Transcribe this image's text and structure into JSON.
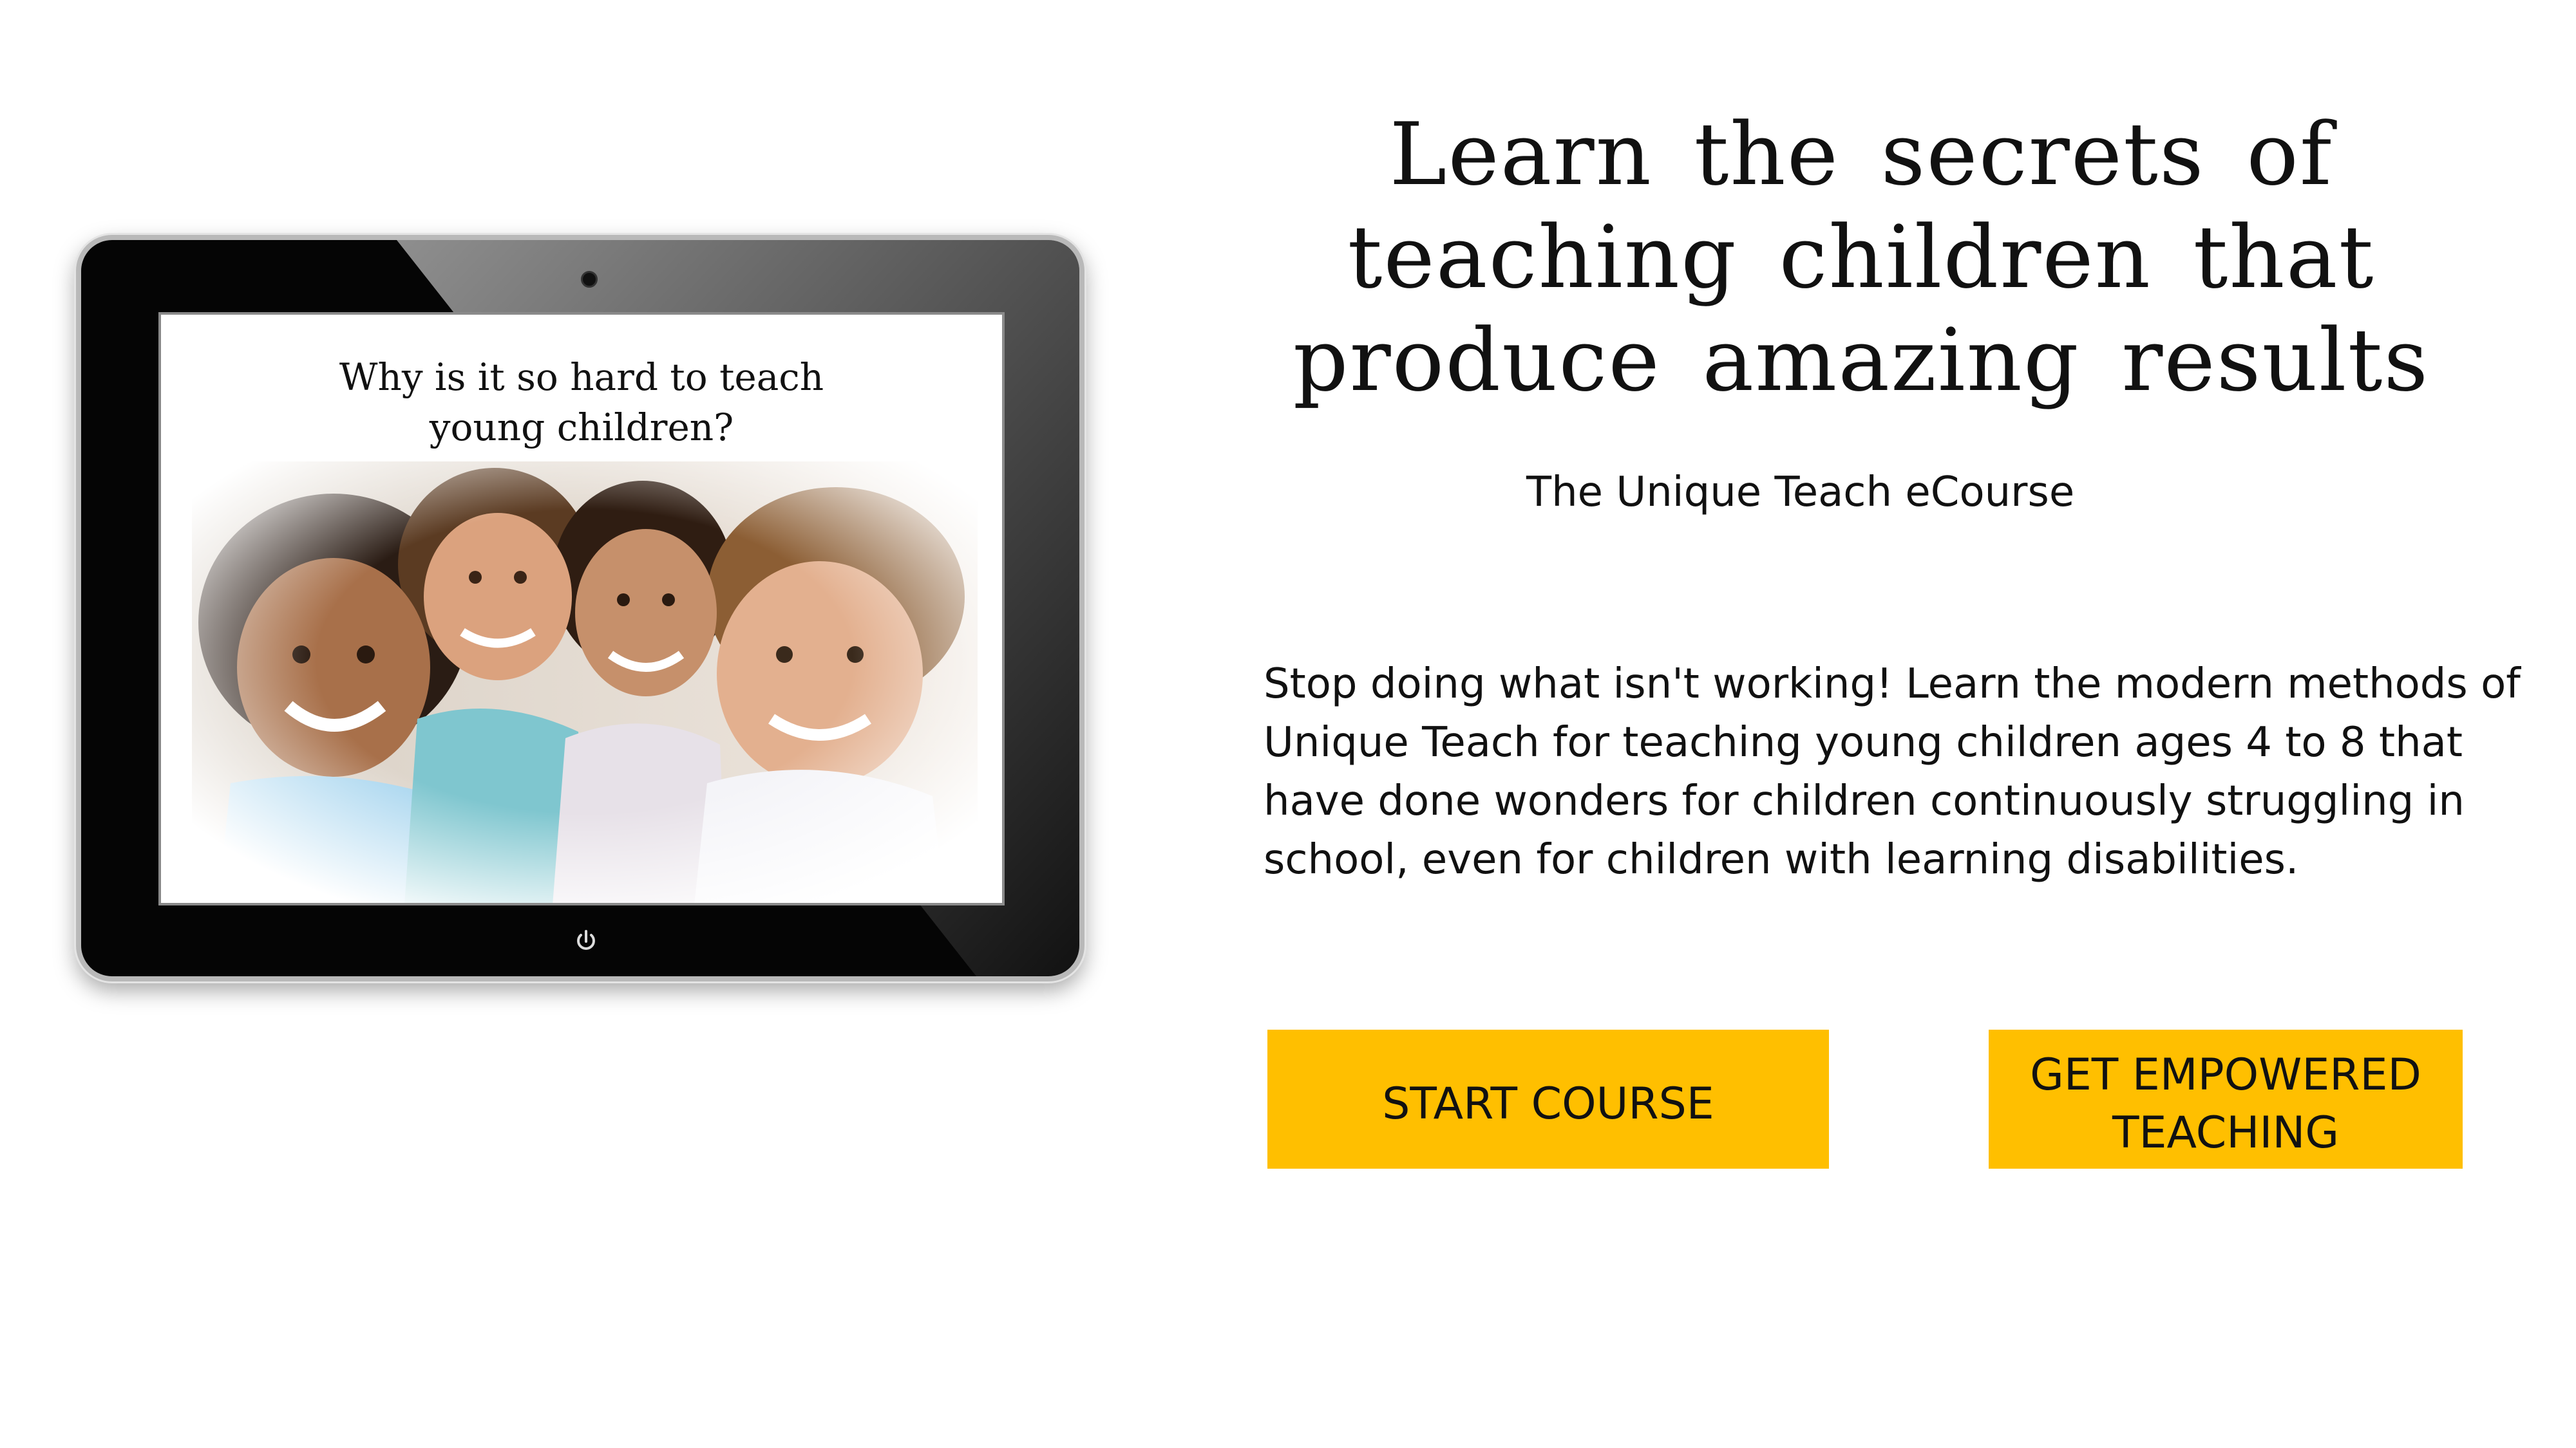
{
  "tablet": {
    "screen_title": "Why is it so hard to teach\nyoung children?",
    "photo_description_icon": "children-photo"
  },
  "hero": {
    "headline": "Learn the secrets of teaching children that produce amazing results",
    "subtitle": "The Unique Teach eCourse",
    "body": "Stop doing what isn't working! Learn the modern methods of Unique Teach for teaching young children ages 4 to 8 that have done wonders for children continuously struggling in school, even for children with learning disabilities."
  },
  "buttons": {
    "start_course": "START COURSE",
    "get_empowered": "GET EMPOWERED TEACHING"
  },
  "colors": {
    "accent": "#ffbf00",
    "text": "#111111",
    "tablet_frame": "#050505"
  }
}
